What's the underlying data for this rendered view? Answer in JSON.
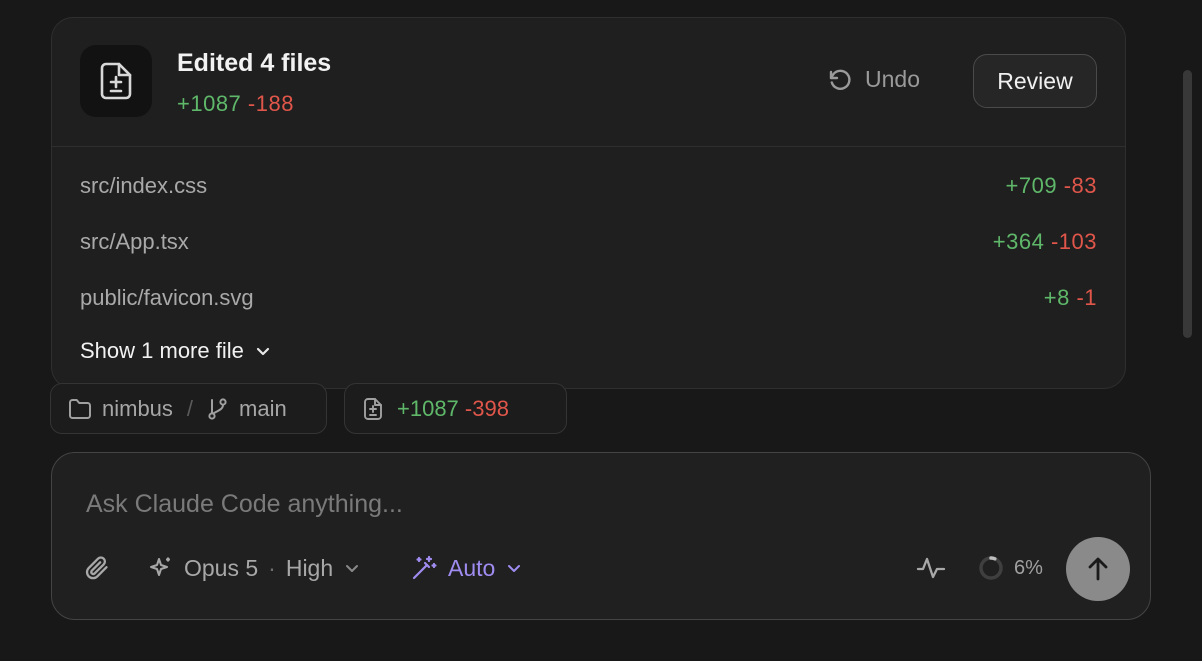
{
  "edits": {
    "title": "Edited 4 files",
    "added": "+1087",
    "removed": "-188",
    "undo_label": "Undo",
    "review_label": "Review",
    "files": [
      {
        "name": "src/index.css",
        "added": "+709",
        "removed": "-83"
      },
      {
        "name": "src/App.tsx",
        "added": "+364",
        "removed": "-103"
      },
      {
        "name": "public/favicon.svg",
        "added": "+8",
        "removed": "-1"
      }
    ],
    "show_more_label": "Show 1 more file"
  },
  "context_chips": {
    "repo": "nimbus",
    "separator": "/",
    "branch": "main",
    "diff_added": "+1087",
    "diff_removed": "-398"
  },
  "composer": {
    "placeholder": "Ask Claude Code anything...",
    "model": "Opus 5",
    "model_sep": "·",
    "effort": "High",
    "mode": "Auto",
    "context_usage": "6%"
  },
  "colors": {
    "added": "#5fb86a",
    "removed": "#e0564a",
    "mode_accent": "#a08cf0"
  },
  "icons": {
    "file_diff": "file-diff-icon",
    "undo": "undo-icon",
    "chevron": "chevron-down-icon",
    "folder": "folder-icon",
    "branch": "git-branch-icon",
    "attach": "paperclip-icon",
    "model": "sparkles-icon",
    "mode": "magic-wand-icon",
    "activity": "activity-icon",
    "context": "context-ring-icon",
    "send": "arrow-up-icon"
  }
}
